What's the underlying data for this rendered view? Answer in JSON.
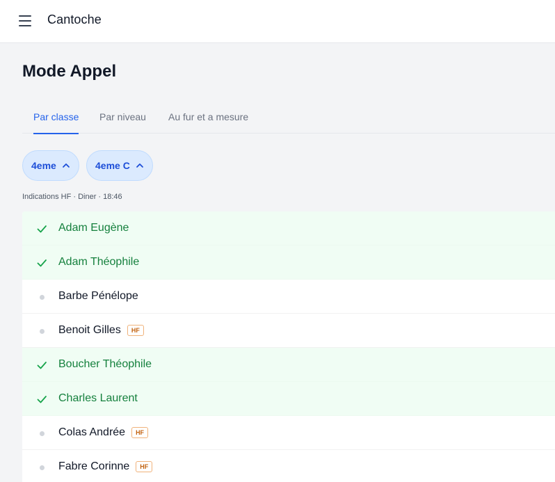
{
  "app": {
    "title": "Cantoche"
  },
  "page": {
    "title": "Mode Appel"
  },
  "tabs": [
    {
      "label": "Par classe",
      "active": true
    },
    {
      "label": "Par niveau",
      "active": false
    },
    {
      "label": "Au fur et a mesure",
      "active": false
    }
  ],
  "filters": [
    {
      "label": "4eme",
      "icon": "chevron-up-icon"
    },
    {
      "label": "4eme C",
      "icon": "chevron-up-icon"
    }
  ],
  "info_line": "Indications HF · Diner · 18:46",
  "colors": {
    "accent": "#2563eb",
    "present_bg": "#f0fdf4",
    "present_text": "#15803d",
    "badge": "#c2620f"
  },
  "students": [
    {
      "name": "Adam Eugène",
      "present": true,
      "badge": ""
    },
    {
      "name": "Adam Théophile",
      "present": true,
      "badge": ""
    },
    {
      "name": "Barbe Pénélope",
      "present": false,
      "badge": ""
    },
    {
      "name": "Benoit Gilles",
      "present": false,
      "badge": "HF"
    },
    {
      "name": "Boucher Théophile",
      "present": true,
      "badge": ""
    },
    {
      "name": "Charles Laurent",
      "present": true,
      "badge": ""
    },
    {
      "name": "Colas Andrée",
      "present": false,
      "badge": "HF"
    },
    {
      "name": "Fabre Corinne",
      "present": false,
      "badge": "HF"
    }
  ]
}
